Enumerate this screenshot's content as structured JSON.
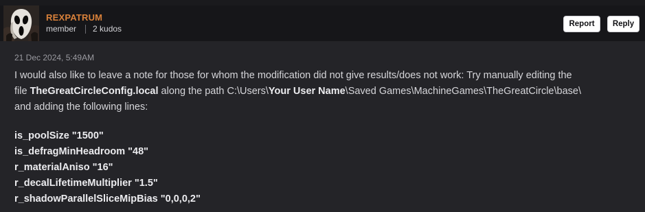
{
  "user": {
    "name": "REXPATRUM",
    "role": "member",
    "kudos": "2 kudos"
  },
  "actions": {
    "report_label": "Report",
    "reply_label": "Reply"
  },
  "post": {
    "timestamp": "21 Dec 2024, 5:49AM",
    "line1": "I would also like to leave a note for those for whom the modification did not give results/does not work: Try manually editing the",
    "line2_prefix": "file ",
    "filename": "TheGreatCircleConfig.local",
    "line2_middle": " along the path C:\\Users\\",
    "user_placeholder": "Your User Name",
    "line2_suffix": "\\Saved Games\\MachineGames\\TheGreatCircle\\base\\",
    "line3": "and adding the following lines:",
    "config_lines": [
      "is_poolSize \"1500\"",
      "is_defragMinHeadroom \"48\"",
      "r_materialAniso \"16\"",
      "r_decalLifetimeMultiplier \"1.5\"",
      "r_shadowParallelSliceMipBias \"0,0,0,2\""
    ]
  },
  "colors": {
    "username": "#d9813a",
    "background": "#242428",
    "header": "#161619"
  },
  "icons": {
    "avatar": "ghostface-mask-avatar"
  }
}
